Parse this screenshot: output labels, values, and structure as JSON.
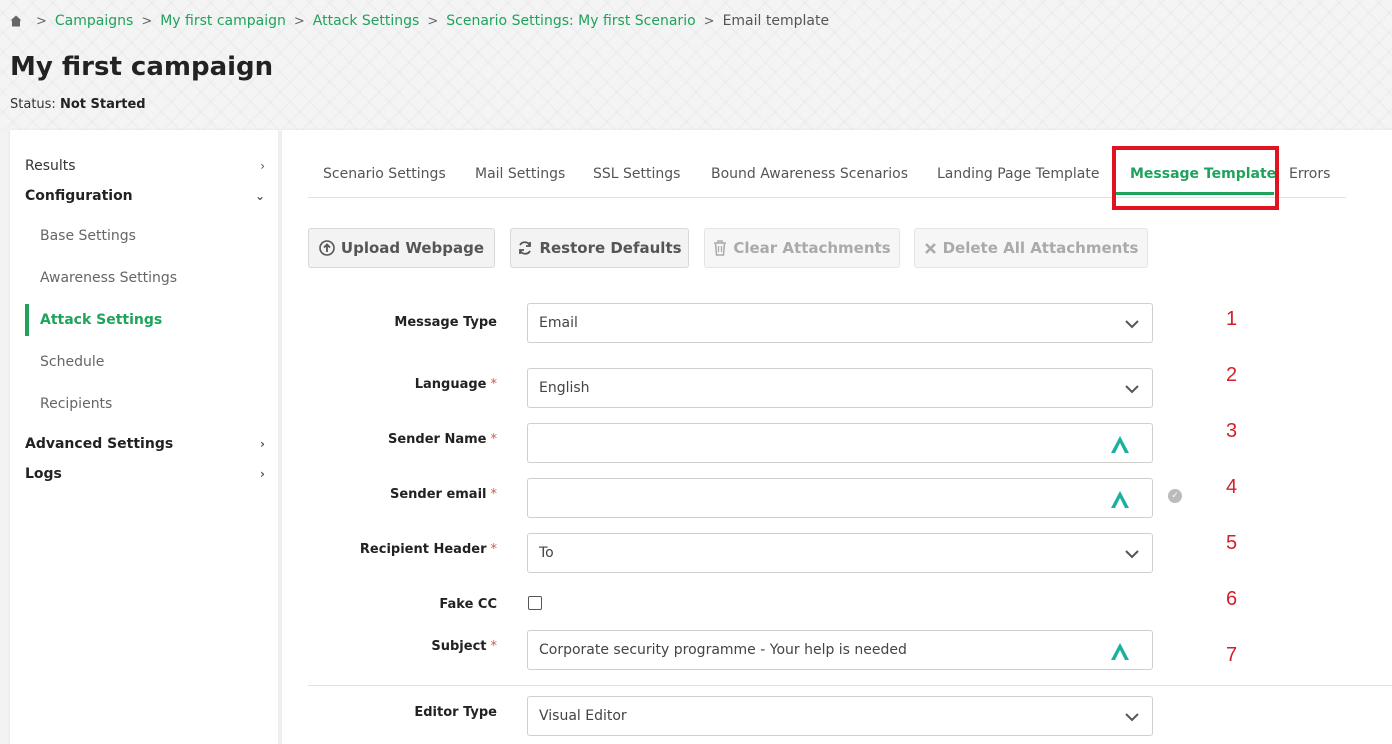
{
  "breadcrumb": {
    "items": [
      "Campaigns",
      "My first campaign",
      "Attack Settings",
      "Scenario Settings: My first Scenario"
    ],
    "current": "Email template",
    "separator": ">"
  },
  "header": {
    "title": "My first campaign",
    "status_label": "Status:",
    "status_value": "Not Started"
  },
  "sidebar": {
    "results": "Results",
    "configuration": "Configuration",
    "sub_items": [
      "Base Settings",
      "Awareness Settings",
      "Attack Settings",
      "Schedule",
      "Recipients"
    ],
    "advanced": "Advanced Settings",
    "logs": "Logs",
    "active_item": "Attack Settings"
  },
  "tabs": [
    "Scenario Settings",
    "Mail Settings",
    "SSL Settings",
    "Bound Awareness Scenarios",
    "Landing Page Template",
    "Message Template",
    "Errors"
  ],
  "active_tab": "Message Template",
  "toolbar": {
    "upload": "Upload Webpage",
    "restore": "Restore Defaults",
    "clear": "Clear Attachments",
    "delete": "Delete All Attachments"
  },
  "form": {
    "message_type_label": "Message Type",
    "message_type_value": "Email",
    "language_label": "Language",
    "language_value": "English",
    "sender_name_label": "Sender Name",
    "sender_name_value": "",
    "sender_email_label": "Sender email",
    "sender_email_value": "",
    "recipient_header_label": "Recipient Header",
    "recipient_header_value": "To",
    "fake_cc_label": "Fake CC",
    "fake_cc_checked": false,
    "subject_label": "Subject",
    "subject_value": "Corporate security programme - Your help is needed",
    "editor_type_label": "Editor Type",
    "editor_type_value": "Visual Editor",
    "required_marker": "*"
  },
  "annotations": [
    "1",
    "2",
    "3",
    "4",
    "5",
    "6",
    "7"
  ],
  "colors": {
    "accent": "#1fa35c",
    "highlight": "#e0141f",
    "annotation": "#d4202a",
    "assist_icon": "#1ab0a0"
  }
}
